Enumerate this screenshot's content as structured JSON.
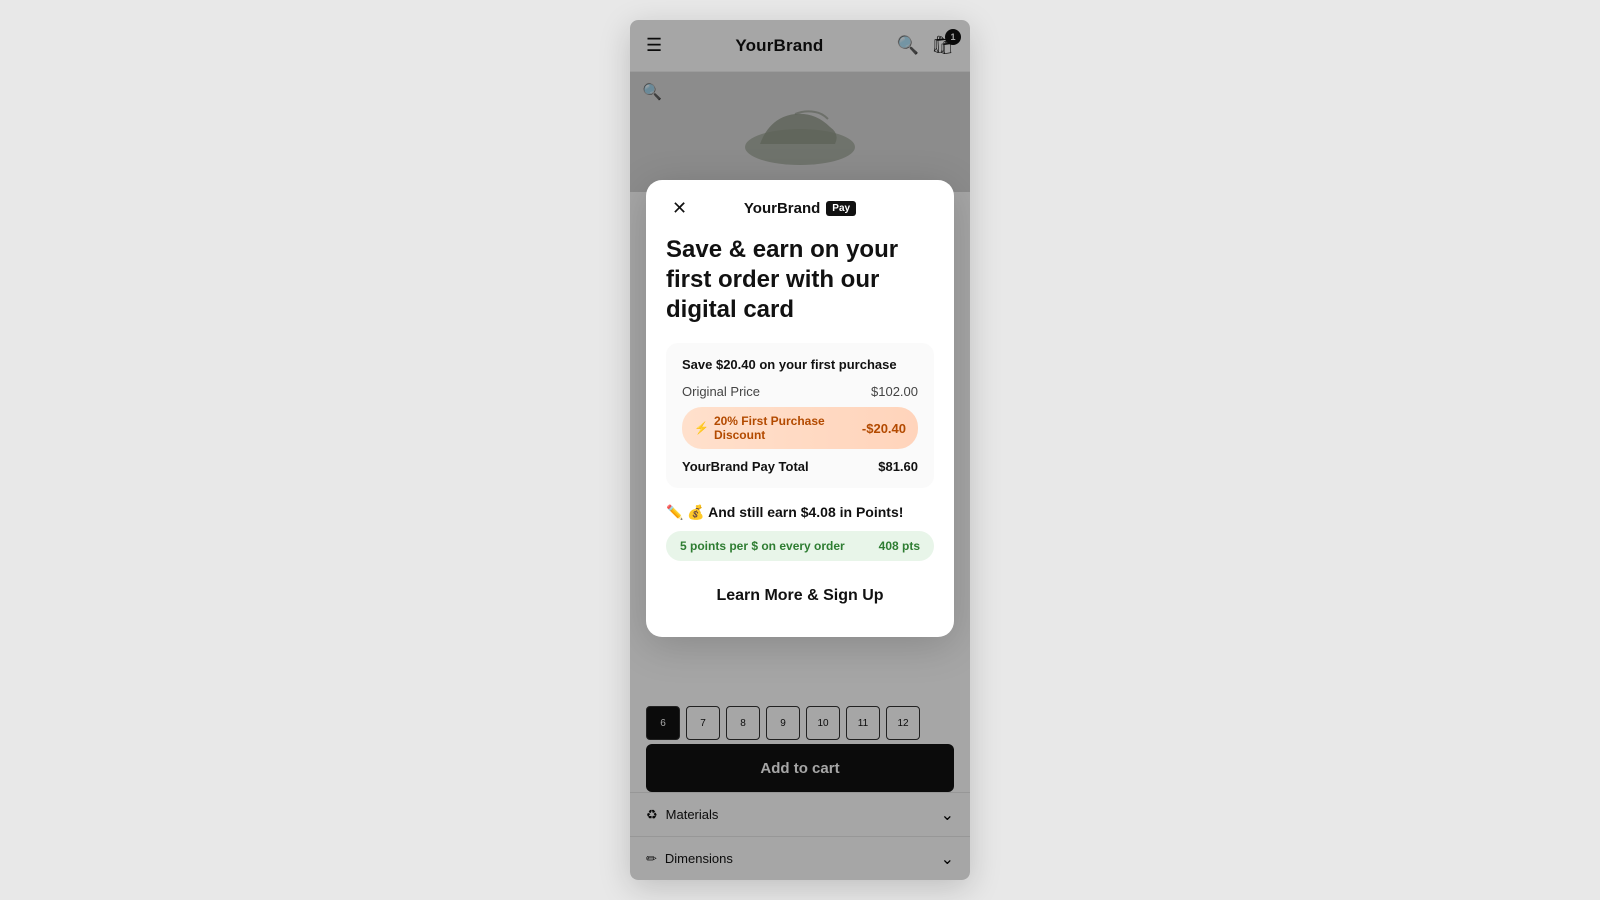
{
  "nav": {
    "brand": "YourBrand",
    "cart_count": "1"
  },
  "page": {
    "add_to_cart": "Add to cart",
    "materials_label": "Materials",
    "dimensions_label": "Dimensions"
  },
  "sizes": [
    "6",
    "7",
    "8",
    "9",
    "10",
    "11",
    "12"
  ],
  "modal": {
    "brand_name": "YourBrand",
    "pay_label": "Pay",
    "title": "Save & earn on your first order with our digital card",
    "savings_headline": "Save $20.40 on your first purchase",
    "original_price_label": "Original Price",
    "original_price_value": "$102.00",
    "discount_label": "20% First Purchase Discount",
    "discount_value": "-$20.40",
    "total_label": "YourBrand Pay Total",
    "total_value": "$81.60",
    "points_headline": "✏️ 💰 And still earn $4.08 in Points!",
    "points_rate": "5 points per $ on every order",
    "points_earned": "408 pts",
    "cta_label": "Learn More & Sign Up"
  }
}
